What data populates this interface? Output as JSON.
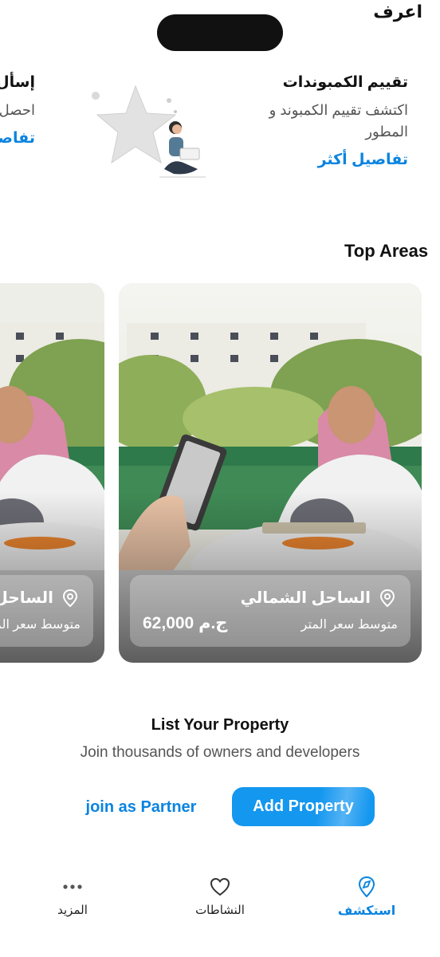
{
  "header": {
    "section_label": "اعرف"
  },
  "info_cards": [
    {
      "title": "تقييم الكمبوندات",
      "description": "اكتشف تقييم الكمبوند و المطور",
      "link": "تفاصيل أكثر"
    },
    {
      "title": "إسأل أ",
      "description": "احصل من س",
      "link": "تفاصيل"
    }
  ],
  "top_areas": {
    "title": "Top Areas",
    "cards": [
      {
        "location": "الساحل الشمالي",
        "subtitle": "متوسط سعر المتر",
        "price": "62,000 ج.م"
      },
      {
        "location": "الساحل",
        "subtitle": "متوسط سعر الم",
        "price": ""
      }
    ]
  },
  "list_property": {
    "title": "List Your Property",
    "subtitle": "Join thousands of owners and developers",
    "partner_label": "join as Partner",
    "add_label": "Add Property"
  },
  "bottom_nav": {
    "more": "المزيد",
    "activities": "النشاطات",
    "explore": "استكشف"
  },
  "colors": {
    "accent": "#0a84e0",
    "button": "#1497ef"
  }
}
